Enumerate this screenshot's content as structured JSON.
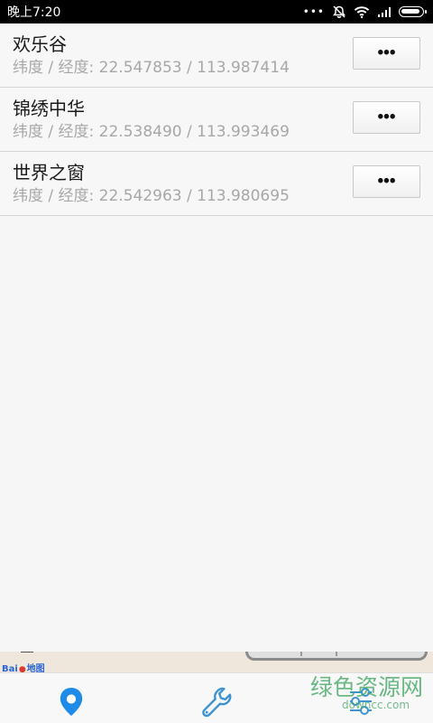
{
  "status_bar": {
    "time": "晚上7:20",
    "more_icon": "more-dots-icon",
    "mute_icon": "notifications-muted-icon",
    "wifi_icon": "wifi-icon",
    "signal_icon": "cell-signal-icon",
    "battery_icon": "battery-icon"
  },
  "locations": [
    {
      "name": "欢乐谷",
      "coordinates": "纬度 / 经度: 22.547853 / 113.987414",
      "more_label": "•••"
    },
    {
      "name": "锦绣中华",
      "coordinates": "纬度 / 经度: 22.538490 / 113.993469",
      "more_label": "•••"
    },
    {
      "name": "世界之窗",
      "coordinates": "纬度 / 经度: 22.542963 / 113.980695",
      "more_label": "•••"
    }
  ],
  "ad": {
    "logo_text_left": "Bai",
    "logo_text_right": "地图"
  },
  "bottom_nav": {
    "items": [
      {
        "name": "location-tab",
        "icon": "location-pin-icon"
      },
      {
        "name": "tools-tab",
        "icon": "wrench-icon"
      },
      {
        "name": "settings-tab",
        "icon": "sliders-icon"
      }
    ]
  },
  "watermark": {
    "main": "绿色资源网",
    "sub": "downcc.com"
  },
  "colors": {
    "status_bar_background": "#000000",
    "background": "#f6f6f6",
    "primary_text": "#1b1b1b",
    "secondary_text": "#a7a7a7",
    "accent_blue": "#1f8be8",
    "tool_icon_blue": "#3e94d0",
    "watermark_green": "#41a563"
  }
}
